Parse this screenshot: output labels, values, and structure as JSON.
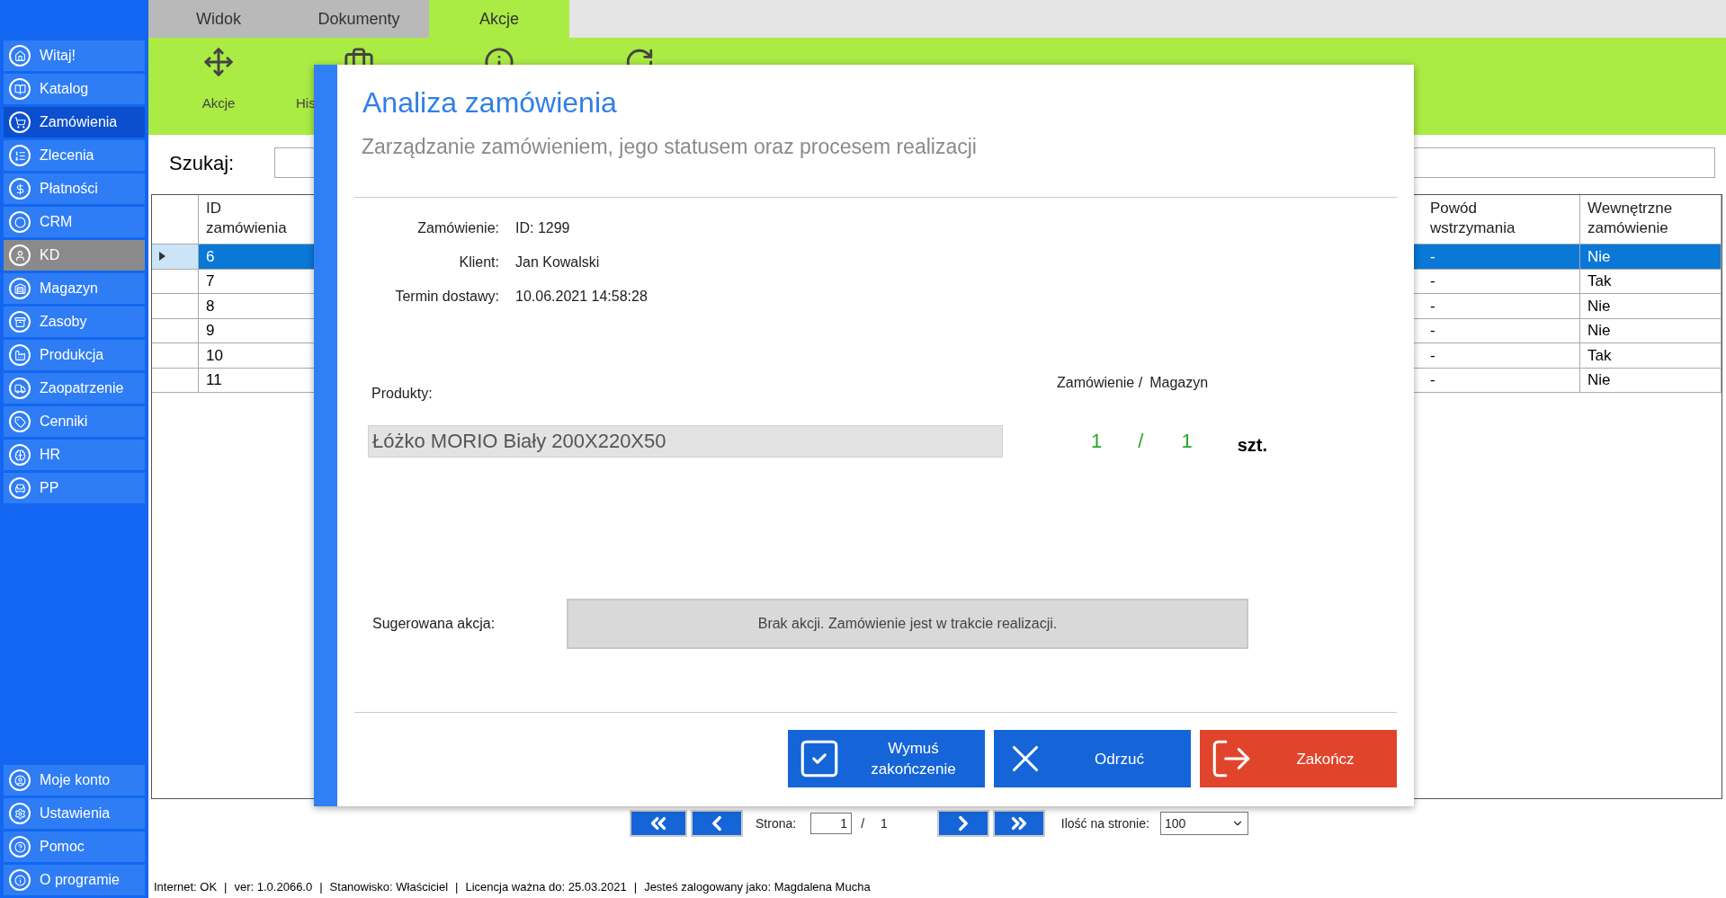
{
  "tabs": [
    {
      "label": "Widok",
      "selected": false
    },
    {
      "label": "Dokumenty",
      "selected": false
    },
    {
      "label": "Akcje",
      "selected": true
    }
  ],
  "sidebar": {
    "items": [
      {
        "label": "Witaj!",
        "selected": false,
        "disabled": false
      },
      {
        "label": "Katalog",
        "selected": false,
        "disabled": false
      },
      {
        "label": "Zamówienia",
        "selected": true,
        "disabled": false
      },
      {
        "label": "Zlecenia",
        "selected": false,
        "disabled": false
      },
      {
        "label": "Płatności",
        "selected": false,
        "disabled": false
      },
      {
        "label": "CRM",
        "selected": false,
        "disabled": false
      },
      {
        "label": "KD",
        "selected": false,
        "disabled": true
      },
      {
        "label": "Magazyn",
        "selected": false,
        "disabled": false
      },
      {
        "label": "Zasoby",
        "selected": false,
        "disabled": false
      },
      {
        "label": "Produkcja",
        "selected": false,
        "disabled": false
      },
      {
        "label": "Zaopatrzenie",
        "selected": false,
        "disabled": false
      },
      {
        "label": "Cenniki",
        "selected": false,
        "disabled": false
      },
      {
        "label": "HR",
        "selected": false,
        "disabled": false
      },
      {
        "label": "PP",
        "selected": false,
        "disabled": false
      }
    ],
    "bottom_items": [
      {
        "label": "Moje konto"
      },
      {
        "label": "Ustawienia"
      },
      {
        "label": "Pomoc"
      },
      {
        "label": "O programie"
      }
    ]
  },
  "toolbar": {
    "labels": [
      "Akcje",
      "His"
    ]
  },
  "search": {
    "label": "Szukaj:"
  },
  "table": {
    "columns": [
      "ID zamówienia",
      "Powód wstrzymania",
      "Wewnętrzne zamówienie"
    ],
    "rows": [
      {
        "cells": [
          "6",
          "-",
          "Nie"
        ],
        "selected": true
      },
      {
        "cells": [
          "7",
          "-",
          "Tak"
        ],
        "selected": false
      },
      {
        "cells": [
          "8",
          "-",
          "Nie"
        ],
        "selected": false
      },
      {
        "cells": [
          "9",
          "-",
          "Nie"
        ],
        "selected": false
      },
      {
        "cells": [
          "10",
          "-",
          "Tak"
        ],
        "selected": false
      },
      {
        "cells": [
          "11",
          "-",
          "Nie"
        ],
        "selected": false
      }
    ]
  },
  "dialog": {
    "title": "Analiza zamówienia",
    "subtitle": "Zarządzanie zamówieniem, jego statusem oraz procesem realizacji",
    "fields": [
      {
        "label": "Zamówienie:",
        "value": "ID: 1299"
      },
      {
        "label": "Klient:",
        "value": "Jan Kowalski"
      },
      {
        "label": "Termin dostawy:",
        "value": "10.06.2021 14:58:28"
      }
    ],
    "products_label": "Produkty:",
    "qty_header_order": "Zamówienie /",
    "qty_header_stock": "Magazyn",
    "products": [
      {
        "name": "Łóżko MORIO Biały 200X220X50",
        "ordered": "1",
        "slash": "/",
        "stock": "1",
        "unit": "szt."
      }
    ],
    "action_label": "Sugerowana akcja:",
    "action_text": "Brak akcji. Zamówienie jest w trakcie realizacji.",
    "buttons": [
      {
        "label": "Wymuś zakończenie",
        "kind": "primary"
      },
      {
        "label": "Odrzuć",
        "kind": "primary"
      },
      {
        "label": "Zakończ",
        "kind": "danger"
      }
    ]
  },
  "pager": {
    "page_label": "Strona:",
    "page": "1",
    "slash": "/",
    "total": "1",
    "per_page_label": "Ilość na stronie:",
    "per_page": "100"
  },
  "status_bar": {
    "separator": "|",
    "items": [
      "Internet: OK",
      "ver: 1.0.2066.0",
      "Stanowisko: Właściciel",
      "Licencja ważna do: 25.03.2021",
      "Jesteś zalogowany jako: Magdalena Mucha"
    ]
  }
}
